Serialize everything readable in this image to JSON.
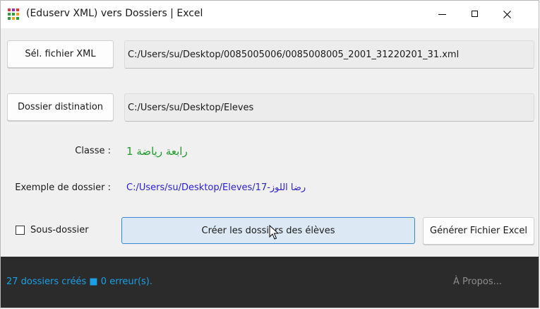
{
  "window": {
    "title": "(Eduserv XML) vers Dossiers | Excel",
    "icon": "app-grid-icon",
    "controls": [
      "minimize-icon",
      "maximize-icon",
      "close-icon"
    ]
  },
  "xml_row": {
    "button_label": "Sél. fichier XML",
    "path": "C:/Users/su/Desktop/0085005006/0085008005_2001_31220201_31.xml"
  },
  "dest_row": {
    "button_label": "Dossier distination",
    "path": "C:/Users/su/Desktop/Eleves"
  },
  "classe": {
    "label": "Classe :",
    "value": "رابعة رياضة 1"
  },
  "example": {
    "label": "Exemple de dossier :",
    "value": "C:/Users/su/Desktop/Eleves/17-رضا اللوز"
  },
  "actions": {
    "subfolder_label": "Sous-dossier",
    "subfolder_checked": false,
    "create_label": "Créer les dossiers des élèves",
    "excel_label": "Générer Fichier Excel"
  },
  "status": {
    "text": "27 dossiers créés ■ 0 erreur(s).",
    "about_label": "À Propos..."
  },
  "colors": {
    "classe_value": "#1f9b2c",
    "example_value": "#2b20d6",
    "status_text": "#1aa0e6",
    "primary_border": "#3b87d1"
  }
}
